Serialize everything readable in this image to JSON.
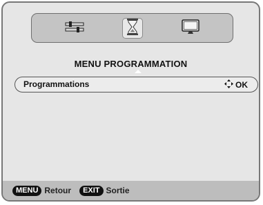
{
  "icons": [
    {
      "name": "settings-sliders-icon",
      "selected": false
    },
    {
      "name": "hourglass-icon",
      "selected": true
    },
    {
      "name": "tv-screen-icon",
      "selected": false
    }
  ],
  "menu": {
    "title": "MENU PROGRAMMATION",
    "items": [
      {
        "label": "Programmations",
        "action": "OK",
        "action_icon": "four-way-arrow-icon"
      }
    ]
  },
  "footer": {
    "buttons": [
      {
        "key": "MENU",
        "label": "Retour"
      },
      {
        "key": "EXIT",
        "label": "Sortie"
      }
    ]
  },
  "colors": {
    "panel": "#e6e6e6",
    "icon_bar": "#c4c4c4",
    "footer_bar": "#bdbdbd",
    "key_badge": "#111111"
  }
}
